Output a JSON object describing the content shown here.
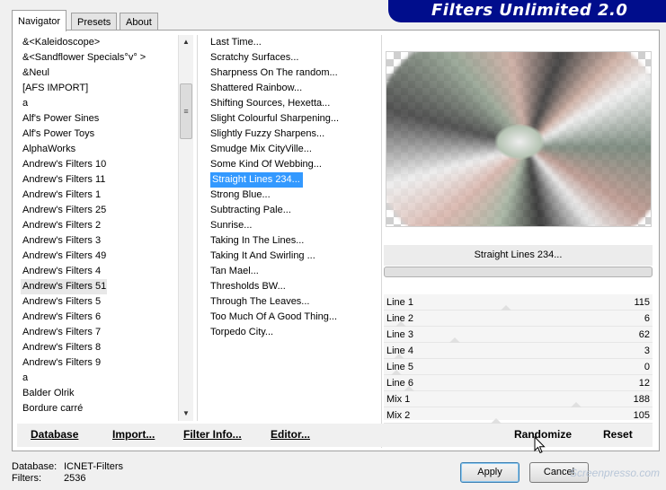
{
  "banner": {
    "title": "Filters Unlimited 2.0"
  },
  "tabs": [
    {
      "label": "Navigator"
    },
    {
      "label": "Presets"
    },
    {
      "label": "About"
    }
  ],
  "categories": [
    "&<Kaleidoscope>",
    "&<Sandflower Specials°v° >",
    "&Neul",
    "[AFS IMPORT]",
    "a",
    "Alf's Power Sines",
    "Alf's Power Toys",
    "AlphaWorks",
    "Andrew's Filters 10",
    "Andrew's Filters 11",
    "Andrew's Filters 1",
    "Andrew's Filters 25",
    "Andrew's Filters 2",
    "Andrew's Filters 3",
    "Andrew's Filters 49",
    "Andrew's Filters 4",
    "Andrew's Filters 51",
    "Andrew's Filters 5",
    "Andrew's Filters 6",
    "Andrew's Filters 7",
    "Andrew's Filters 8",
    "Andrew's Filters 9",
    "a",
    "Balder Olrik",
    "Bordure carré"
  ],
  "filters": [
    "Last Time...",
    "Scratchy Surfaces...",
    "Sharpness On The random...",
    "Shattered Rainbow...",
    "Shifting Sources, Hexetta...",
    "Slight Colourful Sharpening...",
    "Slightly Fuzzy Sharpens...",
    "Smudge Mix CityVille...",
    "Some Kind Of Webbing...",
    "Straight Lines 234...",
    "Strong Blue...",
    "Subtracting Pale...",
    "Sunrise...",
    "Taking In The Lines...",
    "Taking It And Swirling ...",
    "Tan Mael...",
    "Thresholds BW...",
    "Through The Leaves...",
    "Too Much Of A Good Thing...",
    "Torpedo City..."
  ],
  "selected_filter": "Straight Lines 234...",
  "params": [
    {
      "label": "Line 1",
      "value": "115",
      "level": 0.45
    },
    {
      "label": "Line 2",
      "value": "6",
      "level": 0.02
    },
    {
      "label": "Line 3",
      "value": "62",
      "level": 0.24
    },
    {
      "label": "Line 4",
      "value": "3",
      "level": 0.01
    },
    {
      "label": "Line 5",
      "value": "0",
      "level": 0.0
    },
    {
      "label": "Line 6",
      "value": "12",
      "level": 0.05
    },
    {
      "label": "Mix 1",
      "value": "188",
      "level": 0.74
    },
    {
      "label": "Mix 2",
      "value": "105",
      "level": 0.41
    }
  ],
  "toolbar": {
    "database_label": "Database",
    "import_label": "Import...",
    "filter_info_label": "Filter Info...",
    "editor_label": "Editor...",
    "randomize_label": "Randomize",
    "reset_label": "Reset"
  },
  "status": {
    "database_label": "Database:",
    "database_value": "ICNET-Filters",
    "filters_label": "Filters:",
    "filters_value": "2536"
  },
  "buttons": {
    "apply": "Apply",
    "cancel": "Cancel"
  },
  "watermark": "Screenpresso.com",
  "colors": {
    "banner": "#000d8c",
    "selection": "#3399ff"
  }
}
